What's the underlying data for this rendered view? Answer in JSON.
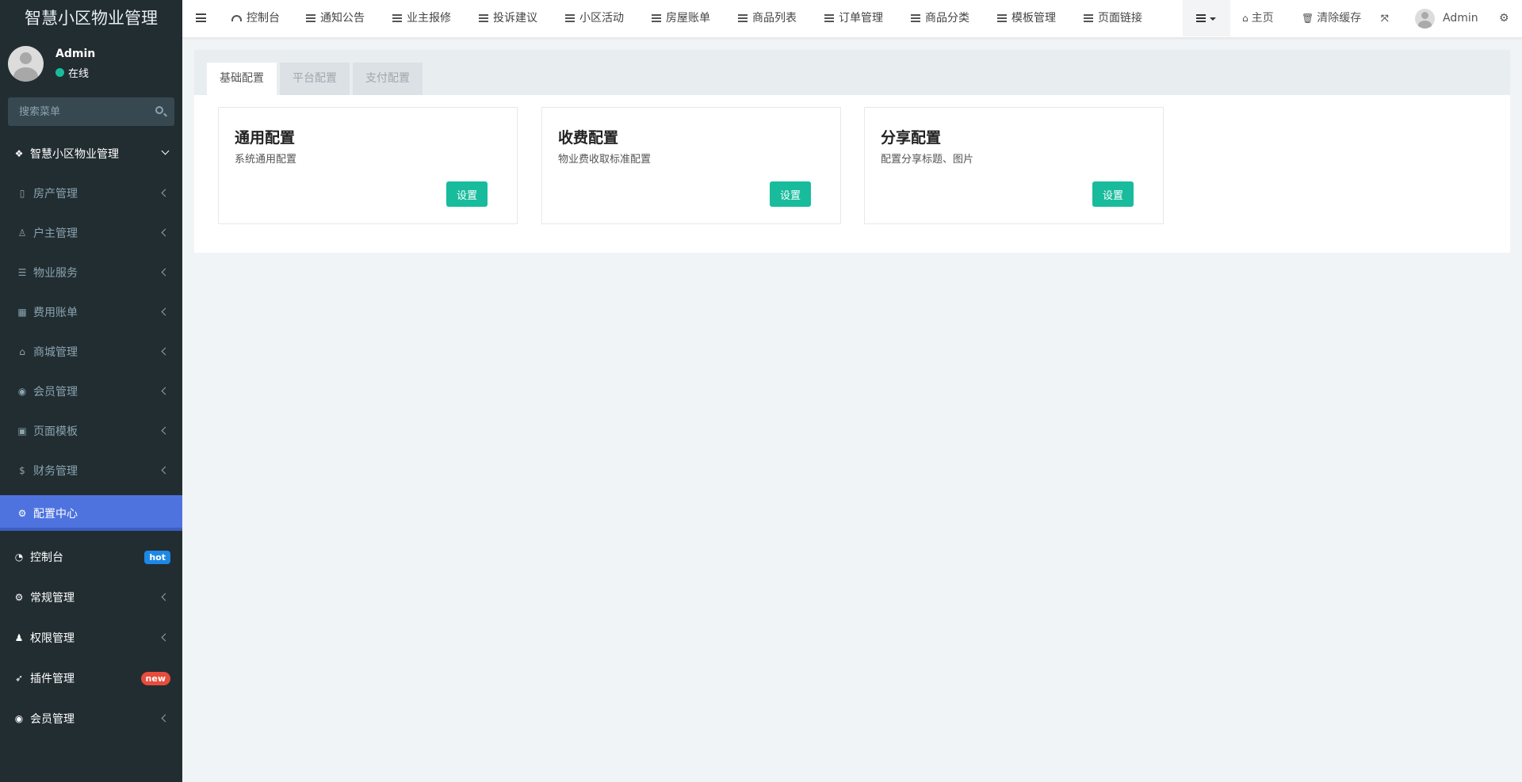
{
  "app": {
    "title": "智慧小区物业管理"
  },
  "user": {
    "name": "Admin",
    "status": "在线"
  },
  "search": {
    "placeholder": "搜索菜单"
  },
  "sidebar": {
    "group": "智慧小区物业管理",
    "sub_items": [
      {
        "label": "房产管理",
        "icon": "building-icon"
      },
      {
        "label": "户主管理",
        "icon": "user-icon"
      },
      {
        "label": "物业服务",
        "icon": "server-icon"
      },
      {
        "label": "费用账单",
        "icon": "calculator-icon"
      },
      {
        "label": "商城管理",
        "icon": "basket-icon"
      },
      {
        "label": "会员管理",
        "icon": "user-circle-icon"
      },
      {
        "label": "页面模板",
        "icon": "image-icon"
      },
      {
        "label": "财务管理",
        "icon": "dollar-icon"
      },
      {
        "label": "配置中心",
        "icon": "gear-icon"
      }
    ],
    "top_items": [
      {
        "label": "控制台",
        "badge": "hot"
      },
      {
        "label": "常规管理"
      },
      {
        "label": "权限管理"
      },
      {
        "label": "插件管理",
        "badge": "new"
      },
      {
        "label": "会员管理"
      }
    ]
  },
  "header": {
    "nav": [
      "控制台",
      "通知公告",
      "业主报修",
      "投诉建议",
      "小区活动",
      "房屋账单",
      "商品列表",
      "订单管理",
      "商品分类",
      "模板管理",
      "页面链接"
    ],
    "home": "主页",
    "clear_cache": "清除缓存",
    "user": "Admin"
  },
  "tabs": [
    "基础配置",
    "平台配置",
    "支付配置"
  ],
  "cards": [
    {
      "title": "通用配置",
      "desc": "系统通用配置",
      "button": "设置"
    },
    {
      "title": "收费配置",
      "desc": "物业费收取标准配置",
      "button": "设置"
    },
    {
      "title": "分享配置",
      "desc": "配置分享标题、图片",
      "button": "设置"
    }
  ],
  "colors": {
    "sidebar": "#222d32",
    "active": "#4e73df",
    "primary": "#18bc9c",
    "hot": "#1e88e5",
    "new": "#e74c3c"
  }
}
